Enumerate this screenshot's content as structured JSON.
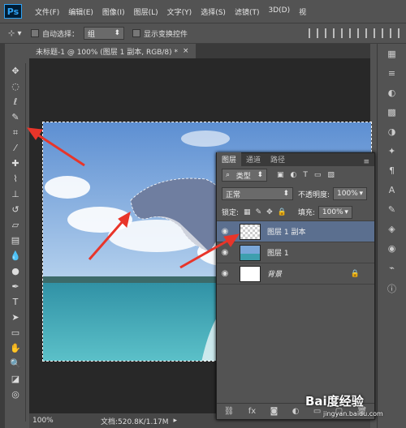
{
  "app": {
    "logo": "Ps"
  },
  "menu": [
    "文件(F)",
    "编辑(E)",
    "图像(I)",
    "图层(L)",
    "文字(Y)",
    "选择(S)",
    "滤镜(T)",
    "3D(D)",
    "视"
  ],
  "options": {
    "auto_select_label": "自动选择：",
    "auto_select_value": "组",
    "show_transform_label": "显示变换控件"
  },
  "document": {
    "tab_title": "未标题-1 @ 100% (图层 1 副本, RGB/8) *"
  },
  "status": {
    "zoom": "100%",
    "doc_info": "文档:520.8K/1.17M"
  },
  "layers_panel": {
    "tabs": [
      "图层",
      "通道",
      "路径"
    ],
    "filter_label": "类型",
    "blend_mode": "正常",
    "opacity_label": "不透明度:",
    "opacity_value": "100%",
    "lock_label": "锁定:",
    "fill_label": "填充:",
    "fill_value": "100%",
    "layers": [
      {
        "name": "图层 1 副本",
        "selected": true
      },
      {
        "name": "图层 1",
        "selected": false
      },
      {
        "name": "背景",
        "selected": false
      }
    ]
  },
  "watermark": "Bai度经验",
  "watermark_url": "jingyan.baidu.com",
  "colors": {
    "accent_arrow": "#e8352a",
    "selected_layer": "#5b6f8f",
    "ps_blue": "#2fa3f6"
  }
}
